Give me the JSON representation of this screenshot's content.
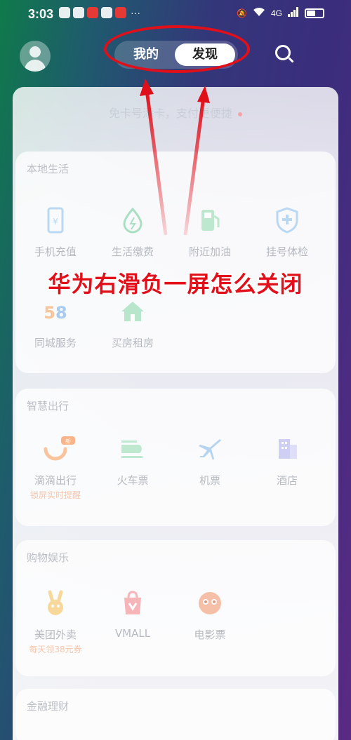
{
  "status_bar": {
    "time": "3:03",
    "more": "···",
    "network": "4G"
  },
  "top_nav": {
    "tab_mine": "我的",
    "tab_discover": "发现"
  },
  "banner": {
    "text": "免卡号添卡，支付更便捷"
  },
  "sections": {
    "local_life": {
      "title": "本地生活",
      "items": [
        {
          "label": "手机充值",
          "icon": "phone-recharge-icon"
        },
        {
          "label": "生活缴费",
          "icon": "utility-bill-icon"
        },
        {
          "label": "附近加油",
          "icon": "gas-station-icon"
        },
        {
          "label": "挂号体检",
          "icon": "hospital-registration-icon"
        },
        {
          "label": "同城服务",
          "icon": "58-city-service-icon"
        },
        {
          "label": "买房租房",
          "icon": "house-icon"
        }
      ]
    },
    "smart_travel": {
      "title": "智慧出行",
      "items": [
        {
          "label": "滴滴出行",
          "sub": "锁屏实时提醒",
          "badge": "新",
          "icon": "didi-icon"
        },
        {
          "label": "火车票",
          "icon": "train-icon"
        },
        {
          "label": "机票",
          "icon": "airplane-icon"
        },
        {
          "label": "酒店",
          "icon": "hotel-icon"
        }
      ]
    },
    "shopping": {
      "title": "购物娱乐",
      "items": [
        {
          "label": "美团外卖",
          "sub": "每天领38元券",
          "icon": "meituan-icon"
        },
        {
          "label": "VMALL",
          "icon": "vmall-bag-icon"
        },
        {
          "label": "电影票",
          "icon": "movie-ticket-icon"
        }
      ]
    },
    "finance": {
      "title": "金融理财"
    }
  },
  "overlay": {
    "caption": "华为右滑负一屏怎么关闭"
  },
  "colors": {
    "accent_red": "#e0101a",
    "muted_text": "#b6bac1"
  }
}
